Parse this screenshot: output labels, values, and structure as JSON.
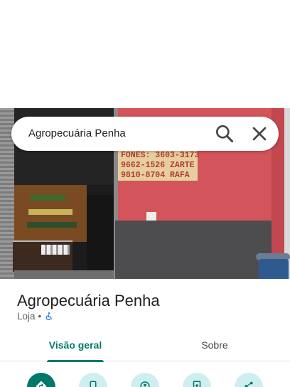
{
  "search": {
    "query": "Agropecuária Penha"
  },
  "photo": {
    "sign_lines": [
      "FONES: 3603-3173",
      "9662-1526 ZARTE",
      "9810-8704 RAFA"
    ]
  },
  "place": {
    "name": "Agropecuária Penha",
    "category": "Loja",
    "separator": "•"
  },
  "tabs": [
    {
      "label": "Visão geral",
      "selected": true
    },
    {
      "label": "Sobre",
      "selected": false
    }
  ],
  "colors": {
    "accent": "#00796b",
    "action_bg": "#cfeef0"
  },
  "actions": [
    {
      "icon": "directions-icon"
    },
    {
      "icon": "phone-icon"
    },
    {
      "icon": "street-view-icon"
    },
    {
      "icon": "save-icon"
    },
    {
      "icon": "share-icon"
    }
  ]
}
